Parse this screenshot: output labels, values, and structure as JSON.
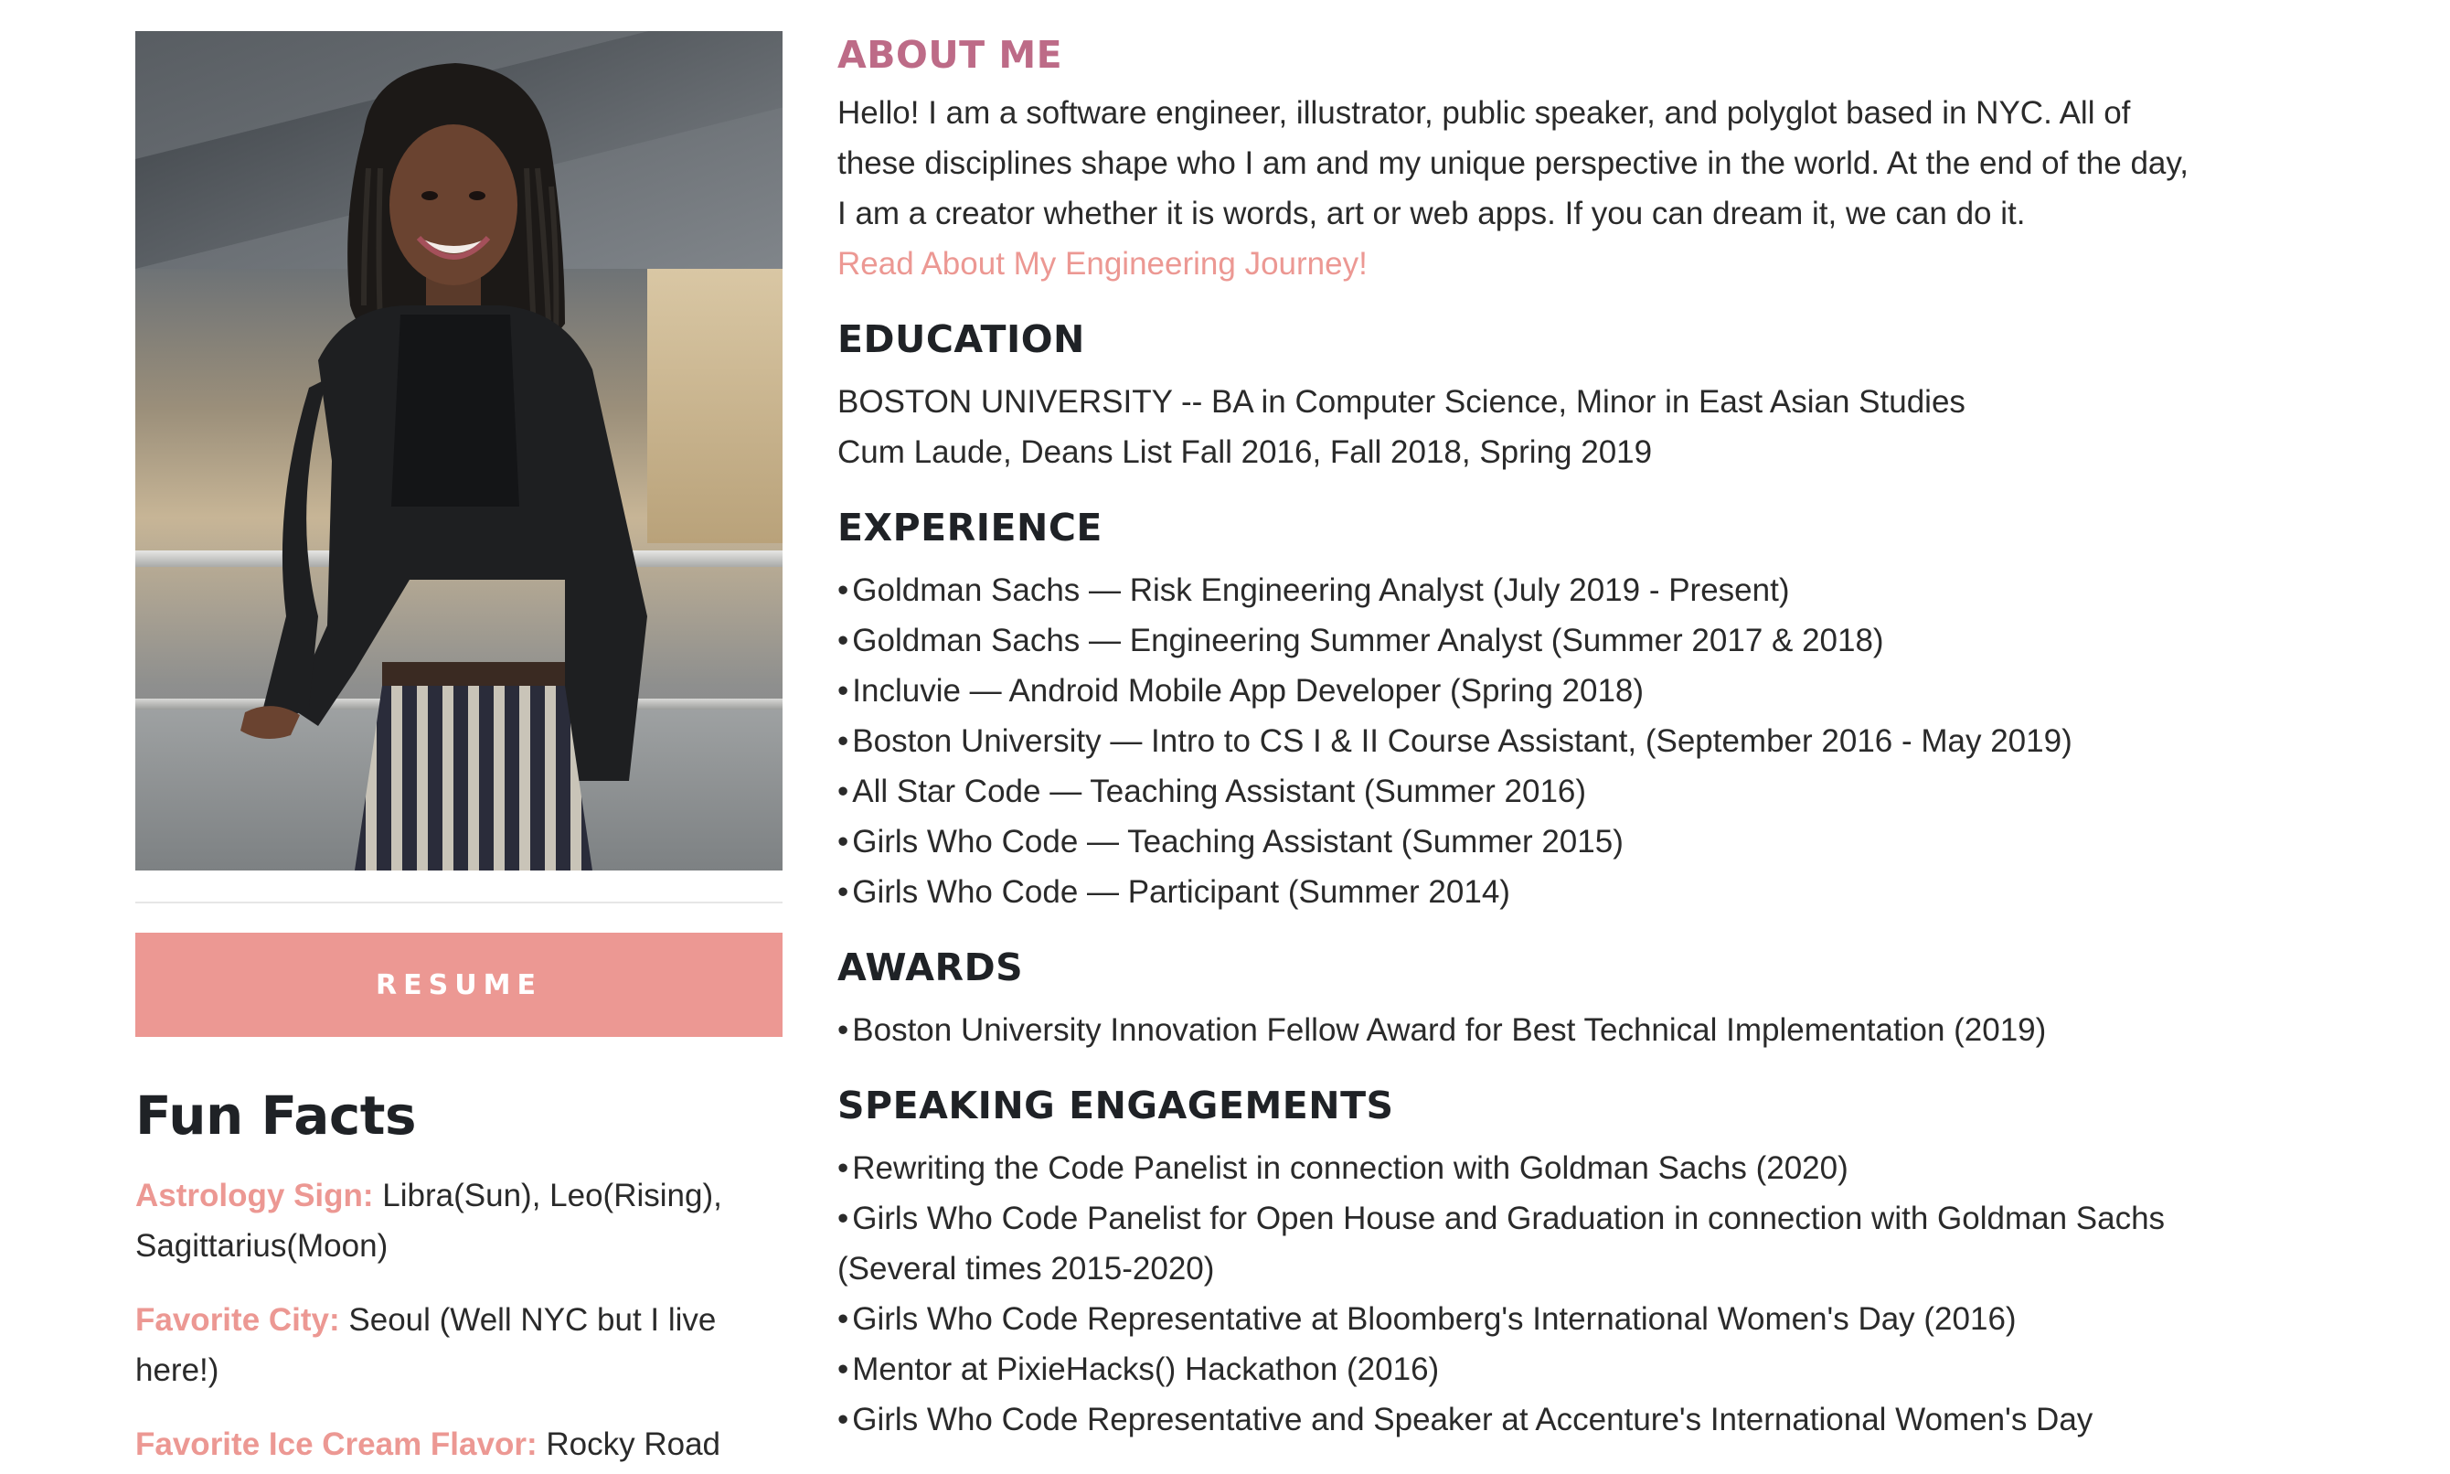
{
  "resume_label": "RESUME",
  "fun_facts": {
    "title": "Fun Facts",
    "items": [
      {
        "label": "Astrology Sign:",
        "value": "Libra(Sun), Leo(Rising), Sagittarius(Moon)"
      },
      {
        "label": "Favorite City:",
        "value": "Seoul (Well NYC but I live here!)"
      },
      {
        "label": "Favorite Ice Cream Flavor:",
        "value": "Rocky Road"
      }
    ]
  },
  "about": {
    "heading": "ABOUT ME",
    "paragraph": "Hello! I am a software engineer, illustrator, public speaker, and polyglot based in NYC. All of these disciplines shape who I am and my unique perspective in the world. At the end of the day, I am a creator whether it is words, art or web apps. If you can dream it, we can do it.",
    "link_text": "Read About My Engineering Journey!"
  },
  "education": {
    "heading": "EDUCATION",
    "lines": [
      "BOSTON UNIVERSITY -- BA in Computer Science, Minor in East Asian Studies",
      "Cum Laude, Deans List Fall 2016, Fall 2018, Spring 2019"
    ]
  },
  "experience": {
    "heading": "EXPERIENCE",
    "items": [
      "Goldman Sachs — Risk Engineering Analyst (July 2019 - Present)",
      "Goldman Sachs — Engineering Summer Analyst (Summer 2017 & 2018)",
      "Incluvie — Android Mobile App Developer (Spring 2018)",
      "Boston University — Intro to CS I & II Course Assistant, (September 2016 - May 2019)",
      "All Star Code — Teaching Assistant (Summer 2016)",
      "Girls Who Code — Teaching Assistant (Summer 2015)",
      "Girls Who Code — Participant (Summer 2014)"
    ]
  },
  "awards": {
    "heading": "AWARDS",
    "items": [
      "Boston University Innovation Fellow Award for Best Technical Implementation (2019)"
    ]
  },
  "speaking": {
    "heading": "SPEAKING ENGAGEMENTS",
    "items": [
      "Rewriting the Code Panelist in connection with Goldman Sachs (2020)",
      "Girls Who Code Panelist for Open House and Graduation in connection with Goldman Sachs (Several times 2015-2020)",
      "Girls Who Code Representative at Bloomberg's International Women's Day (2016)",
      "Mentor at PixieHacks() Hackathon (2016)",
      "Girls Who Code Representative and Speaker at Accenture's International Women's Day"
    ]
  },
  "colors": {
    "accent_pink": "#ec9893",
    "about_heading": "#bd6b87",
    "heading_dark": "#1f2226"
  }
}
